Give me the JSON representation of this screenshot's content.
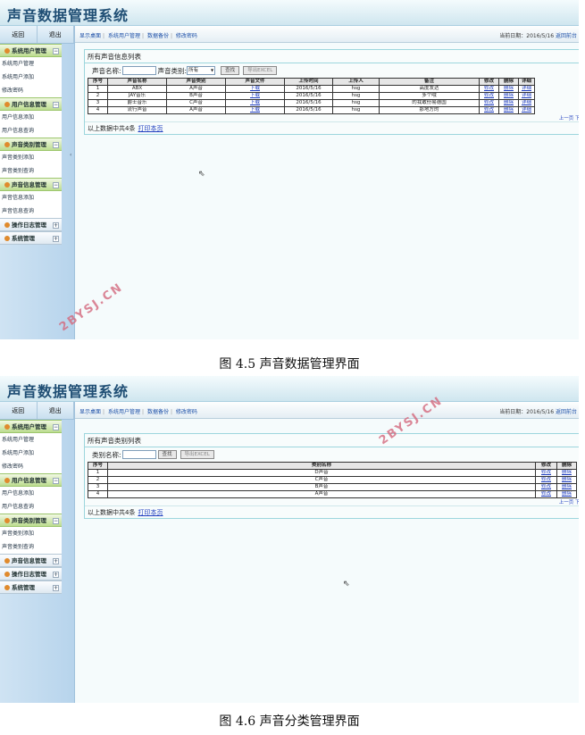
{
  "app_title": "声音数据管理系统",
  "top_buttons": [
    "返回",
    "退出"
  ],
  "top_links": [
    "显示桌面",
    "系统用户管理",
    "数据备份",
    "修改密码"
  ],
  "date_info": "当前日期：2016/5/16",
  "return_link": "返回前台",
  "split_arrow": "‹",
  "cursor_glyph": "⇖",
  "shot1": {
    "sidebar": [
      {
        "type": "section",
        "label": "系统用户管理",
        "toggle": "−"
      },
      {
        "type": "item",
        "label": "系统用户管理"
      },
      {
        "type": "item",
        "label": "系统用户添加"
      },
      {
        "type": "item",
        "label": "修改密码"
      },
      {
        "type": "section",
        "label": "用户信息管理",
        "toggle": "−"
      },
      {
        "type": "item",
        "label": "用户信息添加"
      },
      {
        "type": "item",
        "label": "用户信息查询"
      },
      {
        "type": "section",
        "label": "声音类别管理",
        "toggle": "−"
      },
      {
        "type": "item",
        "label": "声音类别添加"
      },
      {
        "type": "item",
        "label": "声音类别查询"
      },
      {
        "type": "section",
        "label": "声音信息管理",
        "toggle": "−"
      },
      {
        "type": "item",
        "label": "声音信息添加"
      },
      {
        "type": "item",
        "label": "声音信息查询"
      },
      {
        "type": "section_collapsed",
        "label": "操作日志管理",
        "toggle": "+"
      },
      {
        "type": "section_collapsed",
        "label": "系统管理",
        "toggle": "+"
      }
    ],
    "panel_title": "所有声音信息列表",
    "search_name_label": "声音名称:",
    "search_type_label": "声音类别:",
    "select_value": "所有",
    "search_button": "查找",
    "export_button": "导出EXCEL",
    "table_headers": [
      "序号",
      "声音名称",
      "声音类别",
      "声音文件",
      "上传时间",
      "上传人",
      "备注",
      "修改",
      "删除",
      "详细"
    ],
    "rows": [
      [
        "1",
        "ABX",
        "A声音",
        "下载",
        "2016/5/16",
        "hsg",
        "高度发达",
        "修改",
        "删除",
        "详细"
      ],
      [
        "2",
        "JAY音乐",
        "B声音",
        "下载",
        "2016/5/16",
        "hsg",
        "多个哦",
        "修改",
        "删除",
        "详细"
      ],
      [
        "3",
        "爵士音乐",
        "C声音",
        "下载",
        "2016/5/16",
        "hsg",
        "的我敢份易德国",
        "修改",
        "删除",
        "详细"
      ],
      [
        "4",
        "流行声音",
        "A声音",
        "下载",
        "2016/5/16",
        "hsg",
        "那地方的",
        "修改",
        "删除",
        "详细"
      ]
    ],
    "pager": "上一页 下一",
    "footer_text": "以上数据中共4条",
    "print_link": "打印本页"
  },
  "shot2": {
    "sidebar": [
      {
        "type": "section",
        "label": "系统用户管理",
        "toggle": "−"
      },
      {
        "type": "item",
        "label": "系统用户管理"
      },
      {
        "type": "item",
        "label": "系统用户添加"
      },
      {
        "type": "item",
        "label": "修改密码"
      },
      {
        "type": "section",
        "label": "用户信息管理",
        "toggle": "−"
      },
      {
        "type": "item",
        "label": "用户信息添加"
      },
      {
        "type": "item",
        "label": "用户信息查询"
      },
      {
        "type": "section",
        "label": "声音类别管理",
        "toggle": "−"
      },
      {
        "type": "item",
        "label": "声音类别添加"
      },
      {
        "type": "item",
        "label": "声音类别查询"
      },
      {
        "type": "section_collapsed",
        "label": "声音信息管理",
        "toggle": "+"
      },
      {
        "type": "section_collapsed",
        "label": "操作日志管理",
        "toggle": "+"
      },
      {
        "type": "section_collapsed",
        "label": "系统管理",
        "toggle": "+"
      }
    ],
    "panel_title": "所有声音类别列表",
    "search_name_label": "类别名称:",
    "search_button": "查找",
    "export_button": "导出EXCEL",
    "table_headers": [
      "序号",
      "类别名称",
      "修改",
      "删除"
    ],
    "rows": [
      [
        "1",
        "D声音",
        "修改",
        "删除"
      ],
      [
        "2",
        "C声音",
        "修改",
        "删除"
      ],
      [
        "3",
        "B声音",
        "修改",
        "删除"
      ],
      [
        "4",
        "A声音",
        "修改",
        "删除"
      ]
    ],
    "pager": "上一页 下一",
    "footer_text": "以上数据中共4条",
    "print_link": "打印本页"
  },
  "watermark": "2BYSJ.CN",
  "captions": [
    "图 4.5 声音数据管理界面",
    "图 4.6 声音分类管理界面"
  ]
}
